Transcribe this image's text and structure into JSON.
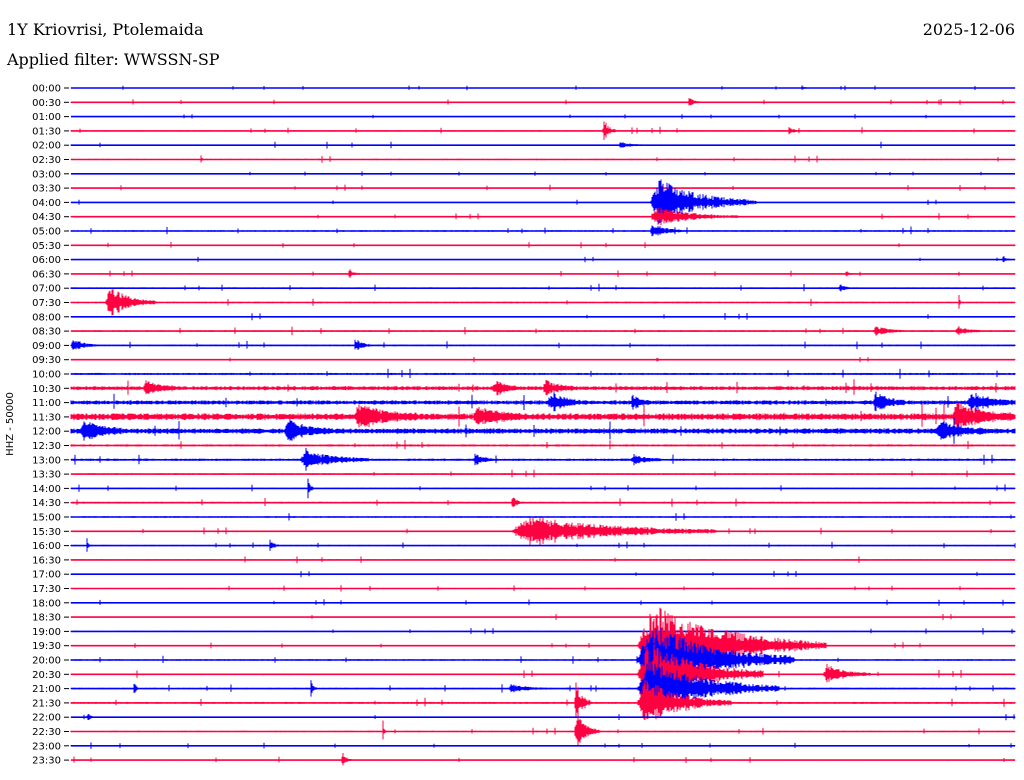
{
  "header": {
    "station": "1Y Kriovrisi, Ptolemaida",
    "date": "2025-12-06",
    "filter": "Applied filter: WWSSN-SP"
  },
  "chart_data": {
    "type": "line",
    "ylabel": "HHZ - 50000",
    "x_unit": "minutes",
    "xlim": [
      0,
      30
    ],
    "colors": {
      "odd_row": "#0000ff",
      "even_row": "#ff0040"
    },
    "row_labels": [
      "00:00",
      "00:30",
      "01:00",
      "01:30",
      "02:00",
      "02:30",
      "03:00",
      "03:30",
      "04:00",
      "04:30",
      "05:00",
      "05:30",
      "06:00",
      "06:30",
      "07:00",
      "07:30",
      "08:00",
      "08:30",
      "09:00",
      "09:30",
      "10:00",
      "10:30",
      "11:00",
      "11:30",
      "12:00",
      "12:30",
      "13:00",
      "13:30",
      "14:00",
      "14:30",
      "15:00",
      "15:30",
      "16:00",
      "16:30",
      "17:00",
      "17:30",
      "18:00",
      "18:30",
      "19:00",
      "19:30",
      "20:00",
      "20:30",
      "21:00",
      "21:30",
      "22:00",
      "22:30",
      "23:00",
      "23:30"
    ],
    "noise_level": [
      0.2,
      0.4,
      0.2,
      0.5,
      0.5,
      0.5,
      0.2,
      0.4,
      0.3,
      0.4,
      0.6,
      0.4,
      0.3,
      0.4,
      0.6,
      0.6,
      0.5,
      0.6,
      0.6,
      0.3,
      0.8,
      1.5,
      1.6,
      2.5,
      2.0,
      0.8,
      0.9,
      0.6,
      0.5,
      0.7,
      0.6,
      0.5,
      0.5,
      0.5,
      0.4,
      0.4,
      0.4,
      0.4,
      0.4,
      0.4,
      0.6,
      0.6,
      0.6,
      0.7,
      0.4,
      0.5,
      0.4,
      0.4
    ],
    "events": [
      {
        "row": 0,
        "start": 23.2,
        "duration": 0.2,
        "amplitude": 3
      },
      {
        "row": 1,
        "start": 19.6,
        "duration": 0.4,
        "amplitude": 5
      },
      {
        "row": 3,
        "start": 16.9,
        "duration": 0.4,
        "amplitude": 12
      },
      {
        "row": 3,
        "start": 22.8,
        "duration": 0.3,
        "amplitude": 5
      },
      {
        "row": 4,
        "start": 17.4,
        "duration": 0.8,
        "amplitude": 3
      },
      {
        "row": 5,
        "start": 4.1,
        "duration": 0.1,
        "amplitude": 8
      },
      {
        "row": 8,
        "start": 18.4,
        "duration": 3.4,
        "amplitude": 24
      },
      {
        "row": 9,
        "start": 18.4,
        "duration": 2.8,
        "amplitude": 10
      },
      {
        "row": 10,
        "start": 18.4,
        "duration": 1.0,
        "amplitude": 8
      },
      {
        "row": 12,
        "start": 29.6,
        "duration": 0.3,
        "amplitude": 4
      },
      {
        "row": 13,
        "start": 8.8,
        "duration": 0.4,
        "amplitude": 5
      },
      {
        "row": 13,
        "start": 24.6,
        "duration": 0.2,
        "amplitude": 4
      },
      {
        "row": 14,
        "start": 24.4,
        "duration": 0.4,
        "amplitude": 4
      },
      {
        "row": 15,
        "start": 1.1,
        "duration": 1.6,
        "amplitude": 16
      },
      {
        "row": 15,
        "start": 28.2,
        "duration": 0.1,
        "amplitude": 10
      },
      {
        "row": 17,
        "start": 25.5,
        "duration": 1.0,
        "amplitude": 5
      },
      {
        "row": 17,
        "start": 28.1,
        "duration": 0.8,
        "amplitude": 5
      },
      {
        "row": 18,
        "start": 0.0,
        "duration": 0.9,
        "amplitude": 6
      },
      {
        "row": 18,
        "start": 9.0,
        "duration": 0.5,
        "amplitude": 8
      },
      {
        "row": 19,
        "start": 18.6,
        "duration": 0.1,
        "amplitude": 5
      },
      {
        "row": 21,
        "start": 2.3,
        "duration": 1.0,
        "amplitude": 8
      },
      {
        "row": 21,
        "start": 13.4,
        "duration": 0.8,
        "amplitude": 8
      },
      {
        "row": 21,
        "start": 15.0,
        "duration": 1.0,
        "amplitude": 8
      },
      {
        "row": 22,
        "start": 15.2,
        "duration": 1.0,
        "amplitude": 10
      },
      {
        "row": 22,
        "start": 17.8,
        "duration": 0.6,
        "amplitude": 8
      },
      {
        "row": 22,
        "start": 25.5,
        "duration": 1.0,
        "amplitude": 10
      },
      {
        "row": 22,
        "start": 28.5,
        "duration": 1.5,
        "amplitude": 10
      },
      {
        "row": 23,
        "start": 9.0,
        "duration": 2.0,
        "amplitude": 12
      },
      {
        "row": 23,
        "start": 12.8,
        "duration": 1.5,
        "amplitude": 10
      },
      {
        "row": 23,
        "start": 28.0,
        "duration": 2.0,
        "amplitude": 12
      },
      {
        "row": 24,
        "start": 0.3,
        "duration": 1.5,
        "amplitude": 10
      },
      {
        "row": 24,
        "start": 6.8,
        "duration": 1.5,
        "amplitude": 10
      },
      {
        "row": 24,
        "start": 27.5,
        "duration": 1.5,
        "amplitude": 10
      },
      {
        "row": 26,
        "start": 7.3,
        "duration": 2.2,
        "amplitude": 9
      },
      {
        "row": 26,
        "start": 12.8,
        "duration": 0.6,
        "amplitude": 7
      },
      {
        "row": 26,
        "start": 17.8,
        "duration": 1.0,
        "amplitude": 5
      },
      {
        "row": 28,
        "start": 7.5,
        "duration": 0.2,
        "amplitude": 12
      },
      {
        "row": 29,
        "start": 14.0,
        "duration": 0.3,
        "amplitude": 8
      },
      {
        "row": 31,
        "start": 14.0,
        "duration": 6.5,
        "amplitude": 16
      },
      {
        "row": 32,
        "start": 0.5,
        "duration": 0.1,
        "amplitude": 10
      },
      {
        "row": 32,
        "start": 6.3,
        "duration": 0.3,
        "amplitude": 6
      },
      {
        "row": 39,
        "start": 18.0,
        "duration": 6.0,
        "amplitude": 42
      },
      {
        "row": 40,
        "start": 18.0,
        "duration": 5.0,
        "amplitude": 38
      },
      {
        "row": 41,
        "start": 18.0,
        "duration": 4.0,
        "amplitude": 34
      },
      {
        "row": 41,
        "start": 23.9,
        "duration": 1.5,
        "amplitude": 10
      },
      {
        "row": 42,
        "start": 18.0,
        "duration": 4.5,
        "amplitude": 30
      },
      {
        "row": 42,
        "start": 13.9,
        "duration": 1.2,
        "amplitude": 4
      },
      {
        "row": 42,
        "start": 7.6,
        "duration": 0.2,
        "amplitude": 10
      },
      {
        "row": 42,
        "start": 2.0,
        "duration": 0.1,
        "amplitude": 16
      },
      {
        "row": 43,
        "start": 16.0,
        "duration": 0.5,
        "amplitude": 22
      },
      {
        "row": 43,
        "start": 18.0,
        "duration": 3.0,
        "amplitude": 24
      },
      {
        "row": 44,
        "start": 0.5,
        "duration": 0.2,
        "amplitude": 6
      },
      {
        "row": 45,
        "start": 16.0,
        "duration": 0.8,
        "amplitude": 18
      },
      {
        "row": 45,
        "start": 9.9,
        "duration": 0.1,
        "amplitude": 14
      },
      {
        "row": 47,
        "start": 8.6,
        "duration": 0.3,
        "amplitude": 10
      }
    ]
  }
}
